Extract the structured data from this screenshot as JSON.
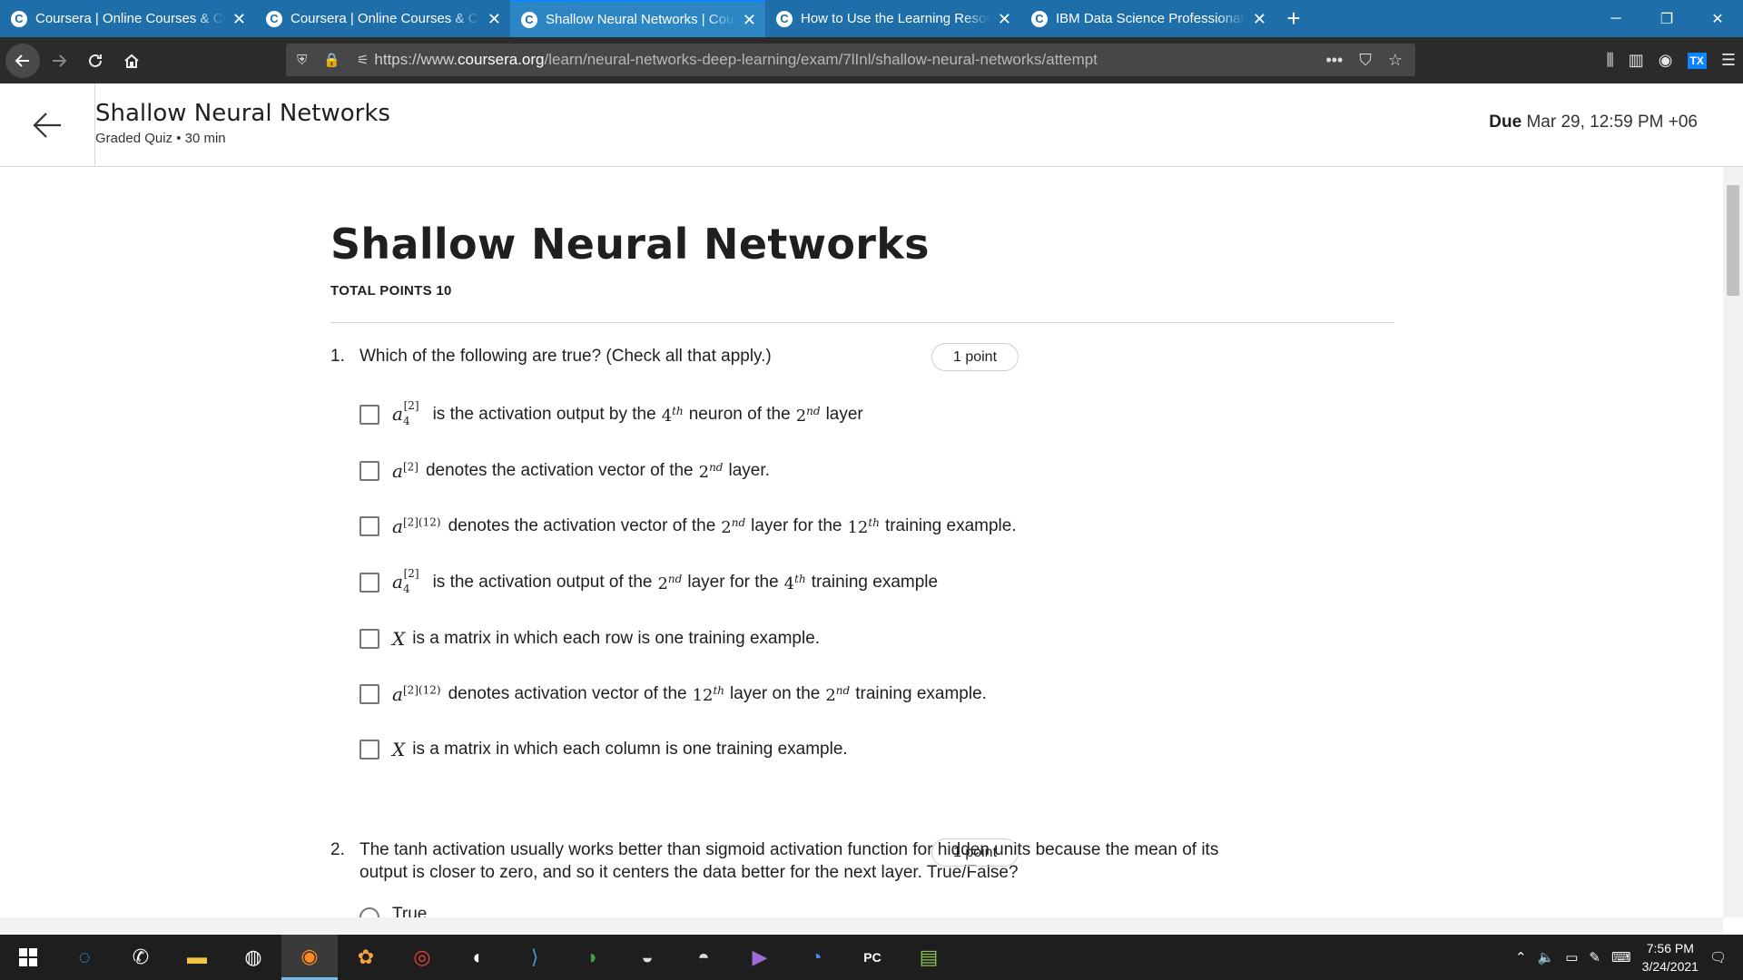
{
  "browser": {
    "tabs": [
      {
        "title": "Coursera | Online Courses & Credentials"
      },
      {
        "title": "Coursera | Online Courses & Credentials"
      },
      {
        "title": "Shallow Neural Networks | Coursera"
      },
      {
        "title": "How to Use the Learning Resources"
      },
      {
        "title": "IBM Data Science Professional Certificate"
      }
    ],
    "url_prefix": "https://www.",
    "url_host": "coursera.org",
    "url_path": "/learn/neural-networks-deep-learning/exam/7lInl/shallow-neural-networks/attempt"
  },
  "header": {
    "title": "Shallow Neural Networks",
    "subtitle": "Graded Quiz • 30 min",
    "due_label": "Due",
    "due_value": "Mar 29, 12:59 PM +06"
  },
  "quiz": {
    "title": "Shallow Neural Networks",
    "total_points": "TOTAL POINTS 10",
    "questions": [
      {
        "number": "1.",
        "text": "Which of the following are true? (Check all that apply.)",
        "points": "1 point",
        "options": [
          {
            "text": "is the activation output by the",
            "t2": "neuron of the",
            "t3": "layer"
          },
          {
            "text": "denotes the activation vector of the",
            "t2": "layer."
          },
          {
            "text": "denotes the activation vector of the",
            "t2": "layer for the",
            "t3": "training example."
          },
          {
            "text": "is the activation output of the",
            "t2": "layer for the",
            "t3": "training example"
          },
          {
            "text": "is a matrix in which each row is one training example."
          },
          {
            "text": "denotes activation vector of the",
            "t2": "layer on the",
            "t3": "training example."
          },
          {
            "text": "is a matrix in which each column is one training example."
          }
        ]
      },
      {
        "number": "2.",
        "text": "The tanh activation usually works better than sigmoid activation function for hidden units because the mean of its output is closer to zero, and so it centers the data better for the next layer. True/False?",
        "points": "1 point",
        "options": [
          {
            "text": "True"
          }
        ]
      }
    ]
  },
  "taskbar": {
    "time": "7:56 PM",
    "date": "3/24/2021"
  }
}
